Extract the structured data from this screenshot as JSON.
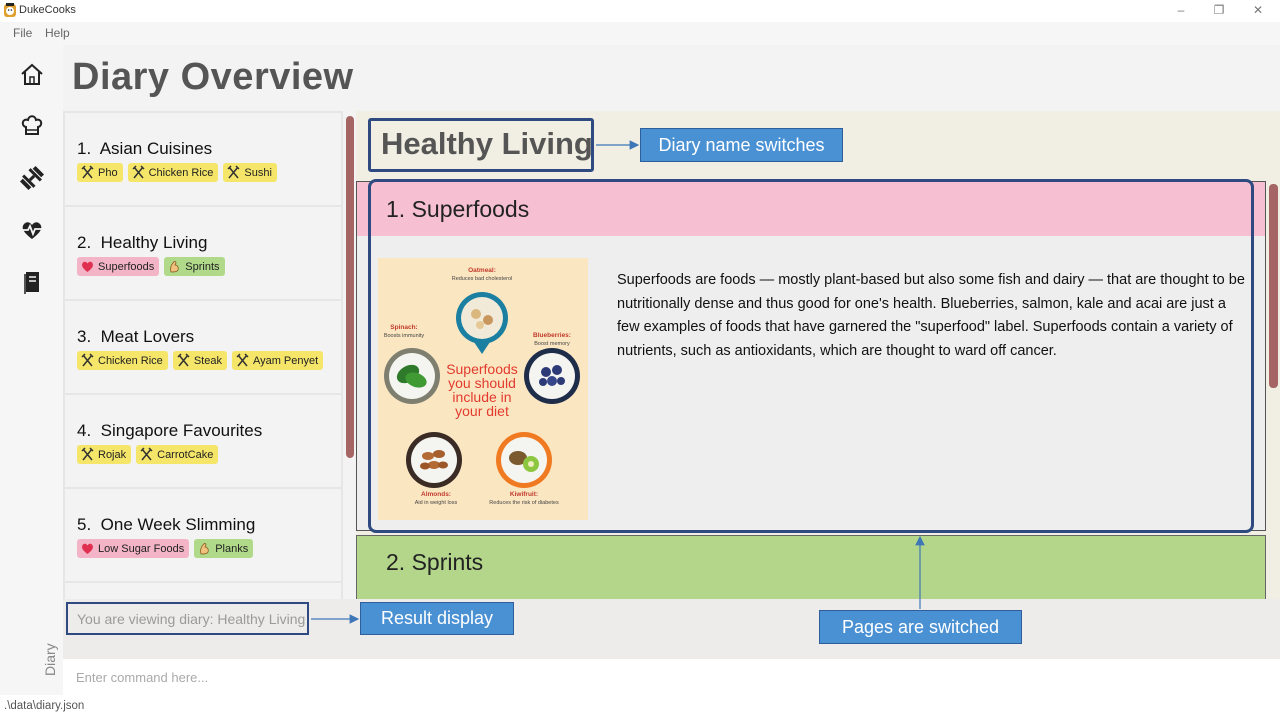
{
  "window": {
    "title": "DukeCooks",
    "controls": [
      "–",
      "❐",
      "✕"
    ]
  },
  "menu": {
    "file": "File",
    "help": "Help"
  },
  "sidebar": {
    "icons": [
      "home-icon",
      "chef-hat-icon",
      "dumbbell-icon",
      "heartbeat-icon",
      "diary-book-icon"
    ],
    "active_label": "Diary"
  },
  "page_title": "Diary Overview",
  "diaries": [
    {
      "number": "1.",
      "name": "Asian Cuisines",
      "tags": [
        {
          "label": "Pho",
          "kind": "recipe"
        },
        {
          "label": "Chicken Rice",
          "kind": "recipe"
        },
        {
          "label": "Sushi",
          "kind": "recipe"
        }
      ]
    },
    {
      "number": "2.",
      "name": "Healthy Living",
      "tags": [
        {
          "label": "Superfoods",
          "kind": "health"
        },
        {
          "label": "Sprints",
          "kind": "exercise"
        }
      ]
    },
    {
      "number": "3.",
      "name": "Meat Lovers",
      "tags": [
        {
          "label": "Chicken Rice",
          "kind": "recipe"
        },
        {
          "label": "Steak",
          "kind": "recipe"
        },
        {
          "label": "Ayam Penyet",
          "kind": "recipe"
        }
      ]
    },
    {
      "number": "4.",
      "name": "Singapore Favourites",
      "tags": [
        {
          "label": "Rojak",
          "kind": "recipe"
        },
        {
          "label": "CarrotCake",
          "kind": "recipe"
        }
      ]
    },
    {
      "number": "5.",
      "name": "One Week Slimming",
      "tags": [
        {
          "label": "Low Sugar Foods",
          "kind": "health"
        },
        {
          "label": "Planks",
          "kind": "exercise"
        }
      ]
    }
  ],
  "current_diary": {
    "name": "Healthy Living",
    "pages": [
      {
        "title": "1. Superfoods",
        "text": "Superfoods are foods — mostly plant-based but also some fish and dairy — that are thought to be nutritionally dense and thus good for one's health. Blueberries, salmon, kale and acai are just a few examples of foods that have garnered the \"superfood\" label. Superfoods contain a variety of nutrients, such as antioxidants, which are thought to ward off cancer.",
        "image": {
          "heading": "Superfoods you should include in your diet",
          "items": [
            {
              "name": "Oatmeal:",
              "desc": "Reduces bad cholesterol"
            },
            {
              "name": "Spinach:",
              "desc": "Boosts immunity"
            },
            {
              "name": "Blueberries:",
              "desc": "Boost memory"
            },
            {
              "name": "Almonds:",
              "desc": "Aid in weight loss"
            },
            {
              "name": "Kiwifruit:",
              "desc": "Reduces the risk of diabetes"
            }
          ]
        }
      },
      {
        "title": "2. Sprints"
      }
    ]
  },
  "result_display": "You are viewing diary: Healthy Living",
  "command_box": {
    "placeholder": "Enter command here...",
    "value": ""
  },
  "status_bar": ".\\data\\diary.json",
  "annotations": {
    "diary_name": "Diary name switches",
    "result": "Result display",
    "pages": "Pages are switched"
  },
  "colors": {
    "recipe_tag": "#f5e66a",
    "health_tag": "#f2b4c6",
    "exercise_tag": "#b0d98a",
    "page1_header": "#f6bfd2",
    "page2_header": "#b3d68b",
    "annotation_frame": "#2e4a80",
    "annotation_label": "#4a91d4"
  }
}
